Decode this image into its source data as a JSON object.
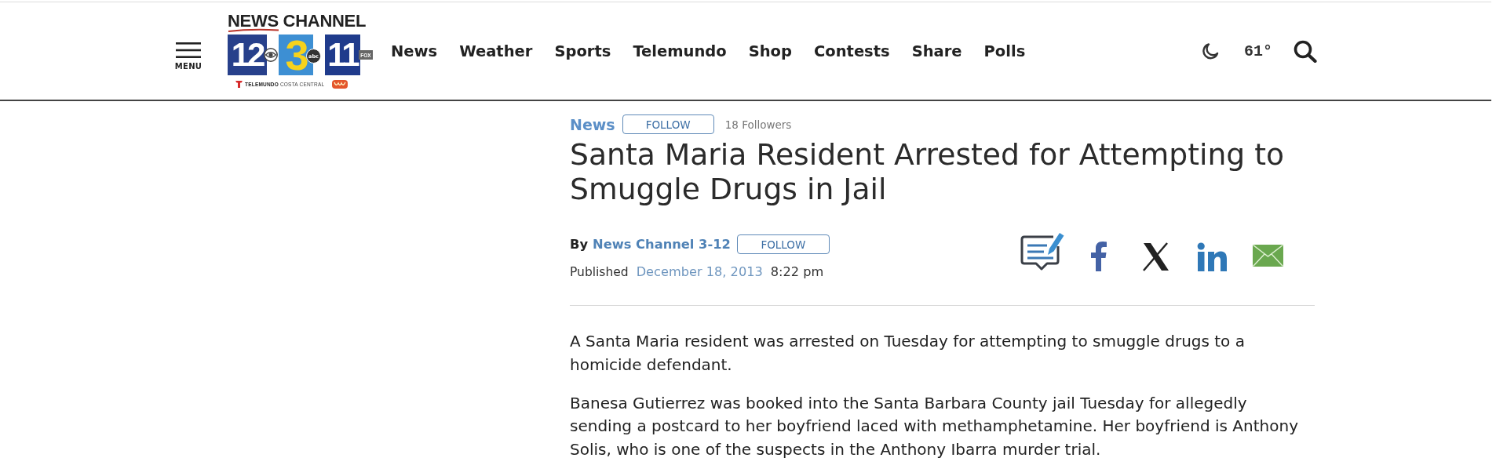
{
  "header": {
    "menu": {
      "label": "MENU"
    },
    "logo": {
      "wordmark": "NEWS CHANNEL",
      "tiles": [
        {
          "kind": "cbs",
          "number": "12"
        },
        {
          "kind": "abc",
          "number": "3",
          "badge": "abc"
        },
        {
          "kind": "fox",
          "number": "11",
          "badge": "FOX"
        }
      ],
      "tagline": "**TELEMUNDO** COSTA CENTRAL"
    },
    "nav": [
      "News",
      "Weather",
      "Sports",
      "Telemundo",
      "Shop",
      "Contests",
      "Share",
      "Polls"
    ],
    "weather": {
      "temperature": "61°"
    }
  },
  "article": {
    "section": {
      "label": "News",
      "follow": "FOLLOW",
      "followers": "18 Followers"
    },
    "title": "Santa Maria Resident Arrested for Attempting to Smuggle Drugs in Jail",
    "byline": {
      "prefix": "By",
      "author": "News Channel 3-12",
      "follow": "FOLLOW"
    },
    "published": {
      "label": "Published",
      "date": "December 18, 2013",
      "time": "8:22 pm"
    },
    "paragraphs": [
      "A Santa Maria resident was arrested on Tuesday for attempting to smuggle drugs to a homicide defendant.",
      "Banesa Gutierrez was booked into the Santa Barbara County jail Tuesday for allegedly sending a postcard to her boyfriend laced with methamphetamine. Her boyfriend is Anthony Solis, who is one of the suspects in the Anthony Ibarra murder trial."
    ]
  }
}
